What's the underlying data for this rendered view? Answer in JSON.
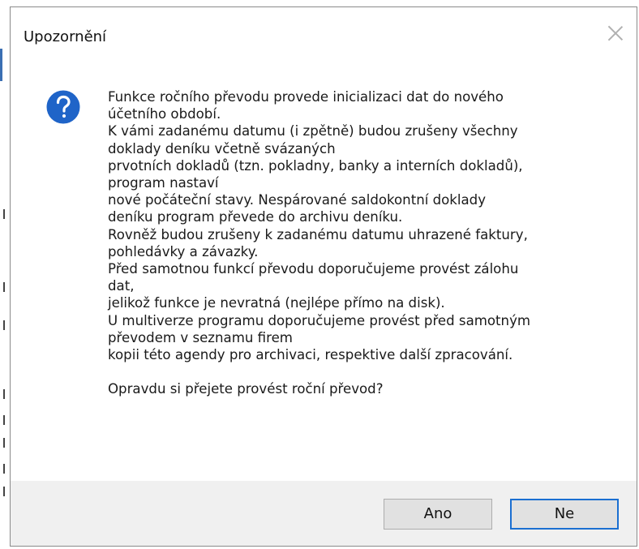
{
  "dialog": {
    "title": "Upozornění",
    "icon": "question-icon",
    "message_lines": [
      "Funkce ročního převodu provede inicializaci dat do nového",
      "účetního období.",
      "K vámi zadanému datumu (i zpětně) budou zrušeny všechny",
      "doklady deníku včetně svázaných",
      "prvotních dokladů (tzn. pokladny, banky a interních dokladů),",
      "program nastaví",
      "nové počáteční stavy. Nespárované saldokontní doklady",
      "deníku program převede do archivu deníku.",
      "Rovněž budou zrušeny k zadanému datumu uhrazené faktury,",
      "pohledávky a závazky.",
      "Před samotnou funkcí převodu doporučujeme provést zálohu",
      "dat,",
      "jelikož funkce je nevratná (nejlépe přímo na disk).",
      "U multiverze programu doporučujeme provést před samotným",
      "převodem v seznamu firem",
      "kopii této agendy pro archivaci, respektive další zpracování.",
      "",
      "Opravdu si přejete provést roční převod?"
    ],
    "buttons": {
      "yes_label": "Ano",
      "no_label": "Ne"
    }
  },
  "colors": {
    "icon_blue": "#1f64c8",
    "default_button_border": "#1b6fd1",
    "footer_bg": "#f0f0f0"
  }
}
